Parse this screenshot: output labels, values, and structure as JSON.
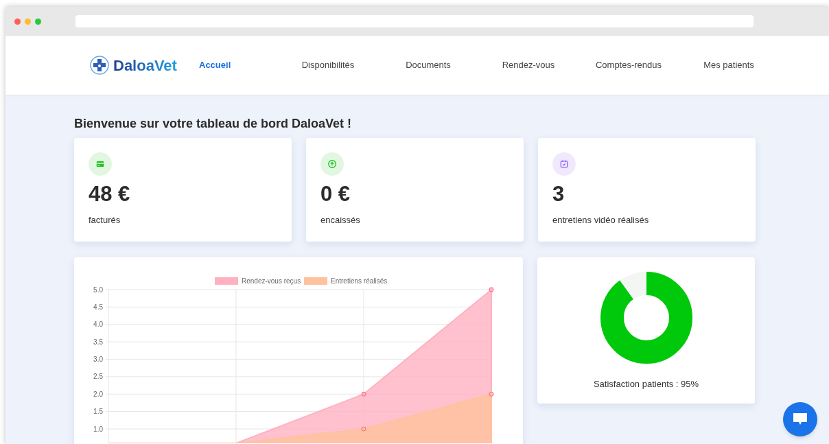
{
  "brand": "DaloaVet",
  "nav": [
    {
      "label": "Accueil",
      "selected": true
    },
    {
      "label": "Disponibilités",
      "selected": false
    },
    {
      "label": "Documents",
      "selected": false
    },
    {
      "label": "Rendez-vous",
      "selected": false
    },
    {
      "label": "Comptes-rendus",
      "selected": false
    },
    {
      "label": "Mes patients",
      "selected": false
    }
  ],
  "heading": "Bienvenue sur votre tableau de bord DaloaVet !",
  "stats": [
    {
      "kind": "card",
      "value": "48 €",
      "label": "facturés",
      "color": "#1fc11f"
    },
    {
      "kind": "upload",
      "value": "0 €",
      "label": "encaissés",
      "color": "#1fc11f"
    },
    {
      "kind": "calendar",
      "value": "3",
      "label": "entretiens vidéo réalisés",
      "color": "#8b5cf6"
    }
  ],
  "chart": {
    "legend": [
      {
        "name": "Rendez-vous reçus",
        "color": "#ffb1c1"
      },
      {
        "name": "Entretiens réalisés",
        "color": "#ffc29e"
      }
    ],
    "y_axis_labels": [
      "5.0",
      "4.5",
      "4.0",
      "3.5",
      "3.0",
      "2.5",
      "2.0",
      "1.5",
      "1.0"
    ]
  },
  "satisfaction": {
    "level": 0.9,
    "label": "Satisfaction patients : 95%"
  }
}
